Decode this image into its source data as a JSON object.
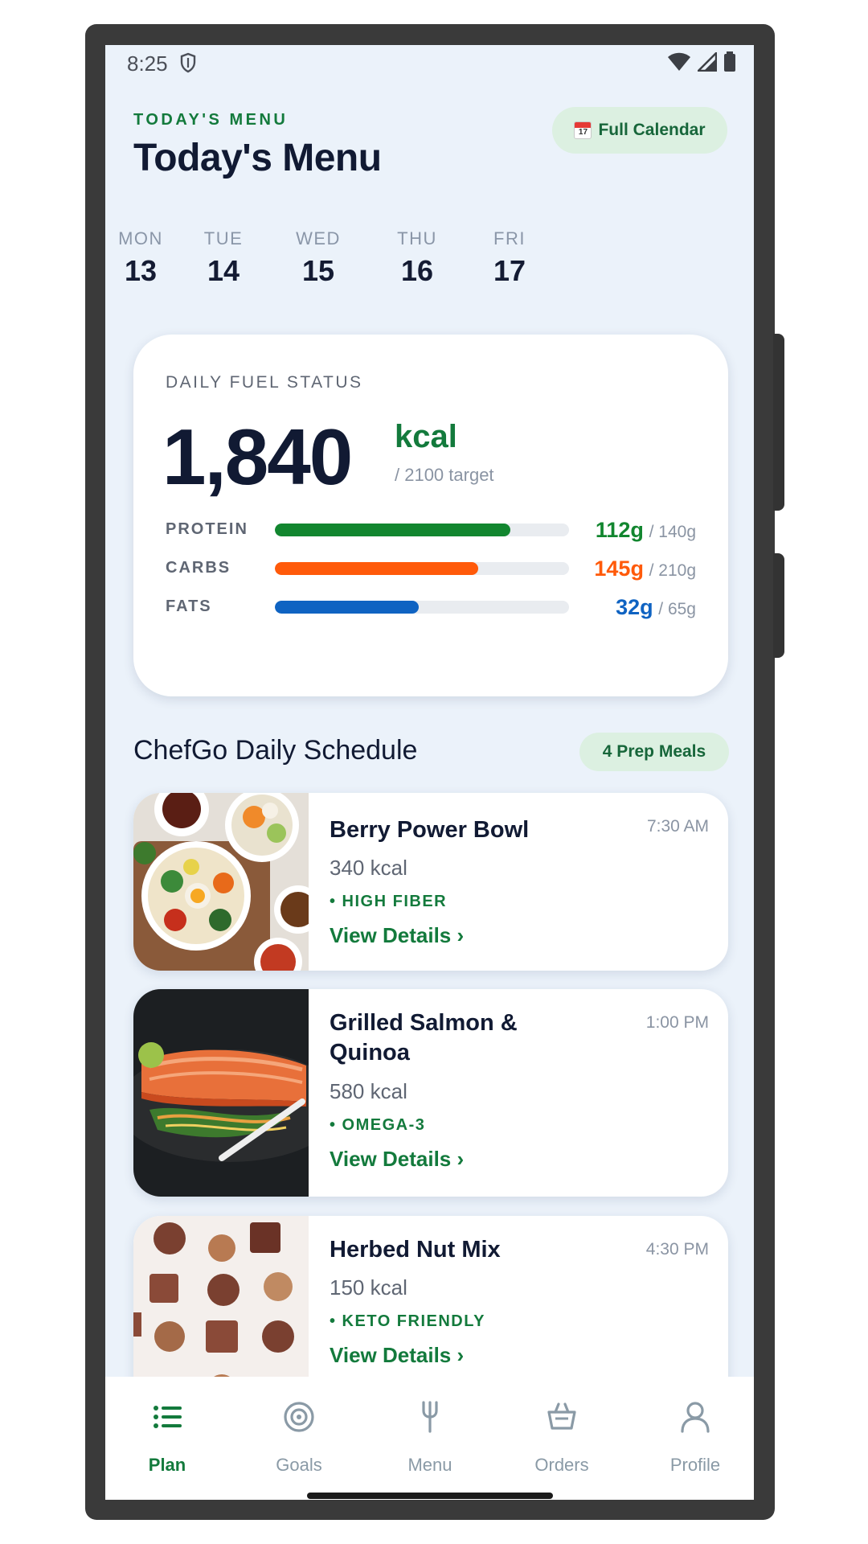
{
  "status_bar": {
    "time": "8:25"
  },
  "header": {
    "eyebrow": "TODAY'S MENU",
    "title": "Today's Menu",
    "calendar_button": "Full Calendar",
    "calendar_icon_day": "17"
  },
  "days": [
    {
      "name": "MON",
      "num": "13"
    },
    {
      "name": "TUE",
      "num": "14"
    },
    {
      "name": "WED",
      "num": "15"
    },
    {
      "name": "THU",
      "num": "16"
    },
    {
      "name": "FRI",
      "num": "17"
    }
  ],
  "fuel": {
    "label": "DAILY FUEL STATUS",
    "kcal": "1,840",
    "unit": "kcal",
    "target": "/ 2100 target",
    "macros": [
      {
        "name": "PROTEIN",
        "value": "112g",
        "goal": "/ 140g",
        "fraction": 0.8,
        "color": "#12862f"
      },
      {
        "name": "CARBS",
        "value": "145g",
        "goal": "/ 210g",
        "fraction": 0.69,
        "color": "#ff5a0a"
      },
      {
        "name": "FATS",
        "value": "32g",
        "goal": "/ 65g",
        "fraction": 0.49,
        "color": "#0f63c2"
      }
    ]
  },
  "schedule": {
    "title": "ChefGo Daily Schedule",
    "badge": "4 Prep Meals",
    "meals": [
      {
        "name": "Berry Power Bowl",
        "time": "7:30 AM",
        "kcal": "340 kcal",
        "tag": "• HIGH FIBER",
        "link": "View Details ›"
      },
      {
        "name": "Grilled Salmon & Quinoa",
        "time": "1:00 PM",
        "kcal": "580 kcal",
        "tag": "• OMEGA-3",
        "link": "View Details ›"
      },
      {
        "name": "Herbed Nut Mix",
        "time": "4:30 PM",
        "kcal": "150 kcal",
        "tag": "• KETO FRIENDLY",
        "link": "View Details ›"
      }
    ]
  },
  "nav": [
    {
      "label": "Plan",
      "icon": "list-icon",
      "active": true
    },
    {
      "label": "Goals",
      "icon": "target-icon",
      "active": false
    },
    {
      "label": "Menu",
      "icon": "fork-icon",
      "active": false
    },
    {
      "label": "Orders",
      "icon": "basket-icon",
      "active": false
    },
    {
      "label": "Profile",
      "icon": "person-icon",
      "active": false
    }
  ],
  "colors": {
    "accent": "#137a3c",
    "background": "#ebf2fa",
    "title": "#111a33"
  }
}
